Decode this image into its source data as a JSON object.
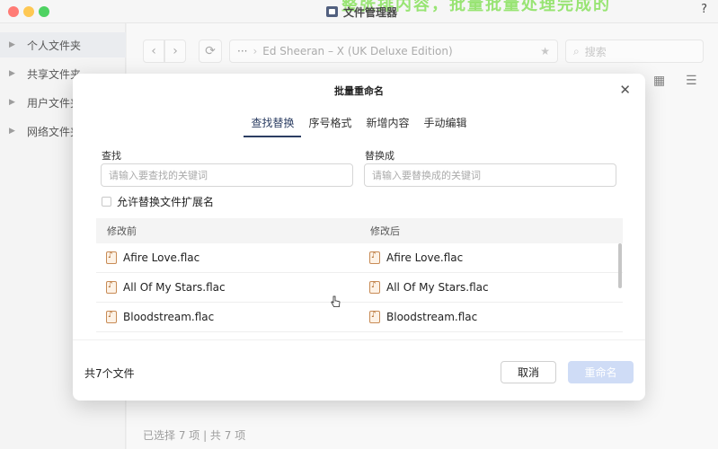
{
  "window": {
    "title": "文件管理器",
    "help": "?",
    "banner_deco": "整张排内容，批量批量处理完成的"
  },
  "sidebar": {
    "items": [
      {
        "label": "个人文件夹"
      },
      {
        "label": "共享文件夹"
      },
      {
        "label": "用户文件夹"
      },
      {
        "label": "网络文件夹"
      }
    ]
  },
  "toolbar": {
    "back": "‹",
    "forward": "›",
    "refresh": "⟳",
    "path_dots": "···",
    "path": "Ed Sheeran – X (UK Deluxe Edition)",
    "star": "★",
    "search_placeholder": "搜索",
    "grid_icon": "▦",
    "sort_icon": "☰"
  },
  "status_bar": "已选择 7 项 | 共 7 项",
  "dialog": {
    "title": "批量重命名",
    "close": "✕",
    "tabs": [
      {
        "label": "查找替换",
        "active": true
      },
      {
        "label": "序号格式",
        "active": false
      },
      {
        "label": "新增内容",
        "active": false
      },
      {
        "label": "手动编辑",
        "active": false
      }
    ],
    "find_label": "查找",
    "find_placeholder": "请输入要查找的关键词",
    "replace_label": "替换成",
    "replace_placeholder": "请输入要替换成的关键词",
    "allow_ext_label": "允许替换文件扩展名",
    "allow_ext_checked": false,
    "col_before": "修改前",
    "col_after": "修改后",
    "rows": [
      {
        "before": "Afire Love.flac",
        "after": "Afire Love.flac"
      },
      {
        "before": "All Of My Stars.flac",
        "after": "All Of My Stars.flac"
      },
      {
        "before": "Bloodstream.flac",
        "after": "Bloodstream.flac"
      }
    ],
    "file_count": "共7个文件",
    "cancel_label": "取消",
    "rename_label": "重命名"
  },
  "colors": {
    "accent": "#2c3e63",
    "primary_disabled": "#cfdcf6",
    "close_dot": "#ff5f57",
    "min_dot": "#febc2e",
    "max_dot": "#28c840"
  }
}
